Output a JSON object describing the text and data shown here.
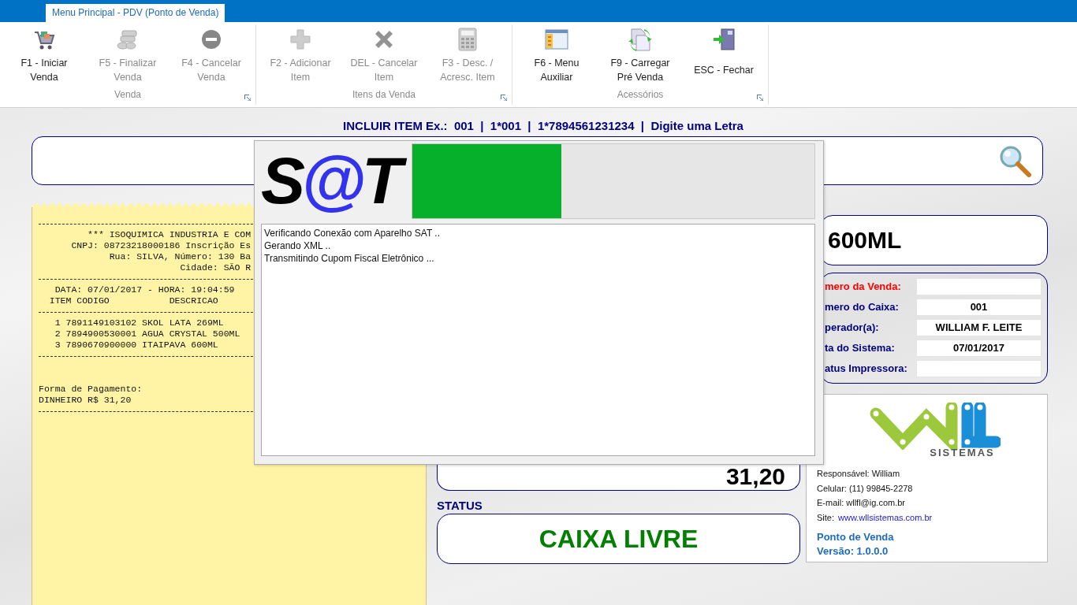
{
  "window_tab": {
    "label": "Menu Principal - PDV (Ponto de Venda)",
    "selected": true
  },
  "ribbon": {
    "groups": [
      {
        "label": "Venda",
        "buttons": [
          {
            "label": "F1 - Iniciar\nVenda",
            "disabled": false
          },
          {
            "label": "F5 - Finalizar\nVenda",
            "disabled": true
          },
          {
            "label": "F4 - Cancelar\nVenda",
            "disabled": true
          }
        ]
      },
      {
        "label": "Itens da Venda",
        "buttons": [
          {
            "label": "F2 - Adicionar\nItem",
            "disabled": true
          },
          {
            "label": "DEL - Cancelar\nItem",
            "disabled": true
          },
          {
            "label": "F3 - Desc. /\nAcresc. Item",
            "disabled": true
          }
        ]
      },
      {
        "label": "Acessórios",
        "buttons": [
          {
            "label": "F6 - Menu\nAuxiliar",
            "disabled": false
          },
          {
            "label": "F9 - Carregar\nPré Venda",
            "disabled": false
          },
          {
            "label": "ESC - Fechar",
            "disabled": false
          }
        ]
      }
    ]
  },
  "hint": "INCLUIR ITEM Ex.:  001  |  1*001  |  1*7894561231234  |  Digite uma Letra",
  "receipt": {
    "lines": [
      {
        "kind": "rule"
      },
      {
        "kind": "text",
        "text": "         *** ISOQUIMICA INDUSTRIA E COM"
      },
      {
        "kind": "text",
        "text": "      CNPJ: 08723218000186 Inscrição Es"
      },
      {
        "kind": "text",
        "text": "             Rua: SILVA, Número: 130 Ba"
      },
      {
        "kind": "text",
        "text": "                          Cidade: SÃO R"
      },
      {
        "kind": "rule"
      },
      {
        "kind": "text",
        "text": "   DATA: 07/01/2017 - HORA: 19:04:59"
      },
      {
        "kind": "text",
        "text": "  ITEM CODIGO           DESCRICAO"
      },
      {
        "kind": "rule"
      },
      {
        "kind": "text",
        "text": "   1 7891149103102 SKOL LATA 269ML"
      },
      {
        "kind": "text",
        "text": "   2 7894900530001 AGUA CRYSTAL 500ML"
      },
      {
        "kind": "text",
        "text": "   3 7890670900000 ITAIPAVA 600ML"
      },
      {
        "kind": "rule"
      },
      {
        "kind": "blank"
      },
      {
        "kind": "blank"
      },
      {
        "kind": "text",
        "text": "Forma de Pagamento:"
      },
      {
        "kind": "text",
        "text": "DINHEIRO R$ 31,20"
      },
      {
        "kind": "rule"
      }
    ]
  },
  "product": {
    "name": "600ML"
  },
  "info": {
    "rows": [
      {
        "label": "mero da Venda:",
        "alert": true
      },
      {
        "label": "mero do Caixa:",
        "alert": false,
        "value": "001"
      },
      {
        "label": "perador(a):",
        "alert": false,
        "value": "WILLIAM F. LEITE"
      },
      {
        "label": "ta do Sistema:",
        "alert": false,
        "value": "07/01/2017"
      },
      {
        "label": "atus Impressora:",
        "alert": false
      }
    ]
  },
  "total": {
    "value": "31,20"
  },
  "status": {
    "label": "STATUS",
    "value": "CAIXA LIVRE"
  },
  "company": {
    "brand": "SISTEMAS",
    "contacts": [
      {
        "kind": "text",
        "text": "Responsável: William"
      },
      {
        "kind": "text",
        "text": "Celular: (11) 99845-2278"
      },
      {
        "kind": "text",
        "text": "E-mail: wllfl@ig.com.br"
      },
      {
        "kind": "link",
        "label": "Site:",
        "text": "www.wllsistemas.com.br"
      }
    ],
    "product": "Ponto de Venda",
    "version": "Versão: 1.0.0.0"
  },
  "dialog": {
    "logo": [
      {
        "text": "S",
        "accent": false
      },
      {
        "text": "@",
        "accent": true
      },
      {
        "text": "T",
        "accent": false
      }
    ],
    "progress": {
      "level": 0.37
    },
    "log": [
      "Verificando Conexão com Aparelho SAT ..",
      "Gerando XML ..",
      "Transmitindo Cupom Fiscal Eletrônico ..."
    ]
  }
}
